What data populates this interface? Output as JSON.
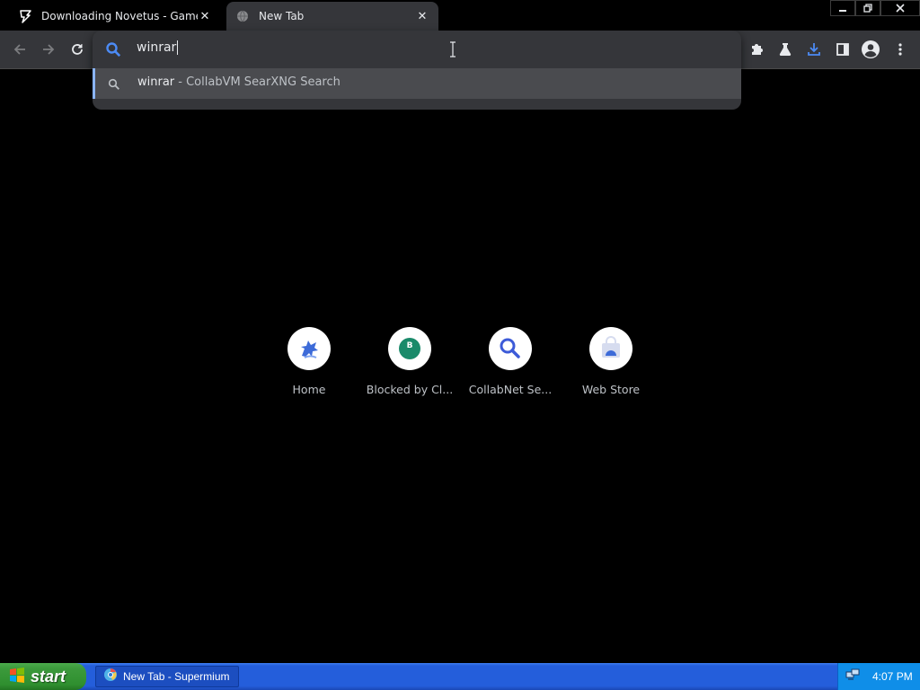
{
  "tabs": [
    {
      "title": "Downloading Novetus - Game Jolt",
      "icon": "game-jolt-icon",
      "active": false
    },
    {
      "title": "New Tab",
      "icon": "globe-icon",
      "active": true
    }
  ],
  "window_controls": {
    "minimize": "minimize-icon",
    "restore": "restore-icon",
    "close": "close-icon"
  },
  "omnibox": {
    "value": "winrar",
    "suggestion_query": "winrar",
    "suggestion_desc": " - CollabVM SearXNG Search"
  },
  "shortcuts": [
    {
      "label": "Home",
      "icon": "home-bird-icon"
    },
    {
      "label": "Blocked by Cl...",
      "icon": "blocked-b-icon",
      "letter": "B"
    },
    {
      "label": "CollabNet Se...",
      "icon": "search-icon"
    },
    {
      "label": "Web Store",
      "icon": "web-store-icon"
    }
  ],
  "taskbar": {
    "start_label": "start",
    "task_label": "New Tab - Supermium",
    "clock": "4:07 PM"
  },
  "colors": {
    "accent": "#8ab4f8",
    "toolbar": "#35363a",
    "download": "#4c8bf5"
  }
}
